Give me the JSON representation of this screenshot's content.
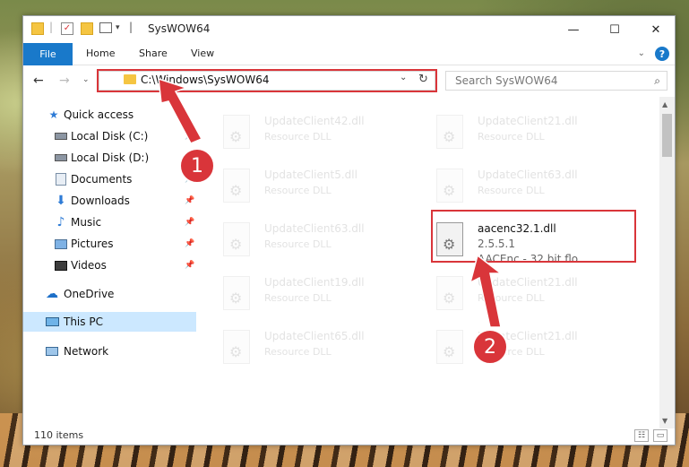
{
  "window": {
    "title": "SysWOW64",
    "controls": {
      "minimize": "—",
      "maximize": "☐",
      "close": "✕"
    }
  },
  "ribbon": {
    "file_tab": "File",
    "tabs": [
      "Home",
      "Share",
      "View"
    ],
    "help": "?"
  },
  "address_bar": {
    "path": "C:\\Windows\\SysWOW64"
  },
  "search": {
    "placeholder": "Search SysWOW64"
  },
  "nav_pane": {
    "items": [
      {
        "label": "Quick access",
        "icon": "star-icon"
      },
      {
        "label": "Local Disk (C:)",
        "icon": "drive-icon"
      },
      {
        "label": "Local Disk (D:)",
        "icon": "drive-icon"
      },
      {
        "label": "Documents",
        "icon": "documents-icon"
      },
      {
        "label": "Downloads",
        "icon": "download-icon"
      },
      {
        "label": "Music",
        "icon": "music-icon"
      },
      {
        "label": "Pictures",
        "icon": "pictures-icon"
      },
      {
        "label": "Videos",
        "icon": "videos-icon"
      },
      {
        "label": "OneDrive",
        "icon": "cloud-icon"
      },
      {
        "label": "This PC",
        "icon": "computer-icon"
      },
      {
        "label": "Network",
        "icon": "network-icon"
      }
    ]
  },
  "files": {
    "left": [
      {
        "name": "UpdateClient42.dll",
        "type": "Resource DLL"
      },
      {
        "name": "UpdateClient5.dll",
        "type": "Resource DLL"
      },
      {
        "name": "UpdateClient63.dll",
        "type": "Resource DLL"
      },
      {
        "name": "UpdateClient19.dll",
        "type": "Resource DLL"
      },
      {
        "name": "UpdateClient65.dll",
        "type": "Resource DLL"
      }
    ],
    "right": [
      {
        "name": "UpdateClient21.dll",
        "type": "Resource DLL"
      },
      {
        "name": "UpdateClient63.dll",
        "type": "Resource DLL"
      },
      {
        "name": "UpdateClient21.dll",
        "type": "Resource DLL"
      },
      {
        "name": "UpdateClient21.dll",
        "type": "Resource DLL"
      }
    ],
    "selected": {
      "name": "aacenc32.1.dll",
      "version": "2.5.5.1",
      "description": "AACEnc - 32 bit flo..."
    }
  },
  "status": {
    "item_count": "110 items"
  },
  "steps": {
    "step1": "1",
    "step2": "2"
  },
  "colors": {
    "accent": "#1979ca",
    "highlight": "#d9353a",
    "selection": "#cce8ff"
  }
}
